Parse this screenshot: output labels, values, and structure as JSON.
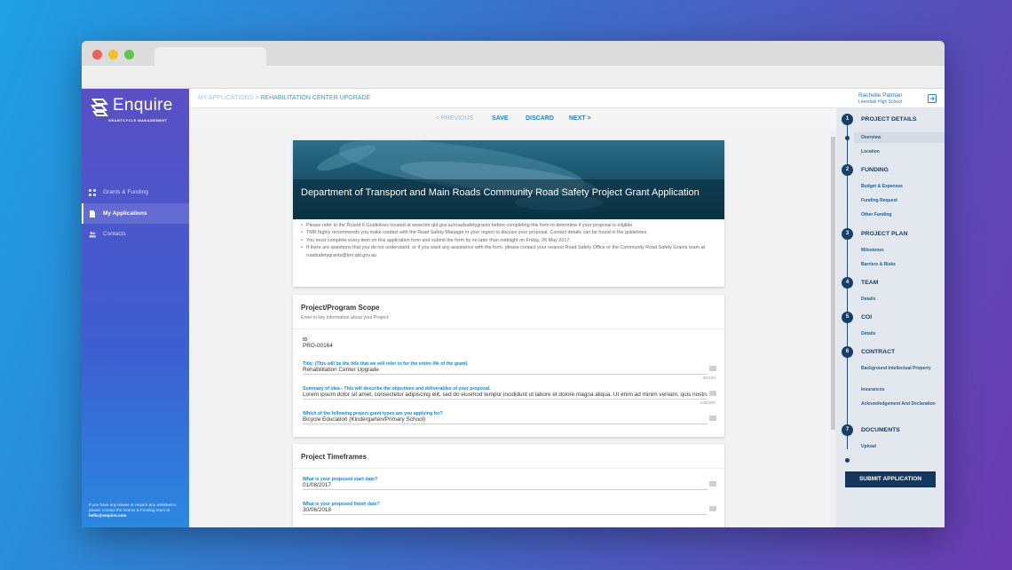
{
  "app": {
    "brand": "Enquire",
    "brand_sub": "GRANTCYCLE MANAGEMENT"
  },
  "sidebar": {
    "items": [
      {
        "label": "Grants & Funding",
        "icon": "grid-icon"
      },
      {
        "label": "My Applications",
        "icon": "document-icon",
        "active": true
      },
      {
        "label": "Contacts",
        "icon": "people-icon"
      }
    ],
    "help_text": "If you have any issues or require any assistance, please contact the Grants & Funding team at ",
    "help_email": "hello@enquire.com"
  },
  "header": {
    "breadcrumb_parent": "MY APPLICATIONS",
    "breadcrumb_sep": ">",
    "breadcrumb_current": "REHABILITATION CENTER UPGRADE",
    "user_name": "Rachelle Patman",
    "user_school": "Leendale High School"
  },
  "toolbar": {
    "previous": "< PREVIOUS",
    "save": "SAVE",
    "discard": "DISCARD",
    "next": "NEXT >"
  },
  "intro": {
    "title": "Department of Transport and Main Roads Community Road Safety Project Grant Application",
    "bullets": [
      "Please refer to the Round 6 Guidelines located at www.tmr.qld.gov.au/roadsafetygrants before completing this form to determine if your proposal is eligible.",
      "TMR highly recommends you make contact with the Road Safety Manager in your region to discuss your proposal. Contact details can be found in the guidelines.",
      "You must complete every item on this application form and submit the form by no later than midnight on Friday, 26 May 2017.",
      "If there are questions that you do not understand, or if you want any assistance with the form, please contact your nearest Road Safety Office or the Community Road Safety Grants team at roadsafetygrants@tmr.qld.gov.au"
    ]
  },
  "scope": {
    "title": "Project/Program Scope",
    "subtitle": "Enter in key information about your Project",
    "id_label": "ID",
    "id_value": "PRO-00164",
    "title_label": "Title: (This will be the title that we will refer to for the entire life of the grant)",
    "title_value": "Rehabilitation Center Upgrade",
    "title_count": "30/100",
    "summary_label": "Summary of idea - This will describe the objectives and deliverables of your proposal.",
    "summary_value": "Lorem ipsum dolor sit amet, consectetur adipiscing elit, sed do eiusmod tempor incididunt ut labore et dolore magna aliqua. Ut enim ad minim veniam, quis nostrud",
    "summary_count": "445/300",
    "type_label": "Which of the following project grant types are you applying for?",
    "type_value": "Bicycle Education (Kindergarten/Primary School)"
  },
  "timeframes": {
    "title": "Project Timeframes",
    "start_label": "What is your proposed start date?",
    "start_value": "01/08/2017",
    "finish_label": "What is your proposed finish date?",
    "finish_value": "30/06/2018"
  },
  "steps": [
    {
      "num": "1",
      "label": "PROJECT DETAILS",
      "subs": [
        "Overview",
        "Location"
      ]
    },
    {
      "num": "2",
      "label": "FUNDING",
      "subs": [
        "Budget & Expenses",
        "Funding Request",
        "Other Funding"
      ]
    },
    {
      "num": "3",
      "label": "PROJECT PLAN",
      "subs": [
        "Milestones",
        "Barriers & Risks"
      ]
    },
    {
      "num": "4",
      "label": "TEAM",
      "subs": [
        "Details"
      ]
    },
    {
      "num": "5",
      "label": "COI",
      "subs": [
        "Details"
      ]
    },
    {
      "num": "6",
      "label": "CONTRACT",
      "subs": [
        "Background Intellectual Property",
        "Insurances",
        "Acknowledgement And Declaration"
      ]
    },
    {
      "num": "7",
      "label": "DOCUMENTS",
      "subs": [
        "Upload"
      ]
    }
  ],
  "submit_label": "SUBMIT APPLICATION",
  "colors": {
    "accent": "#1f86c9",
    "step_navy": "#173e66",
    "sidebar_top": "#5a4fc4",
    "sidebar_bottom": "#2b88e0"
  }
}
